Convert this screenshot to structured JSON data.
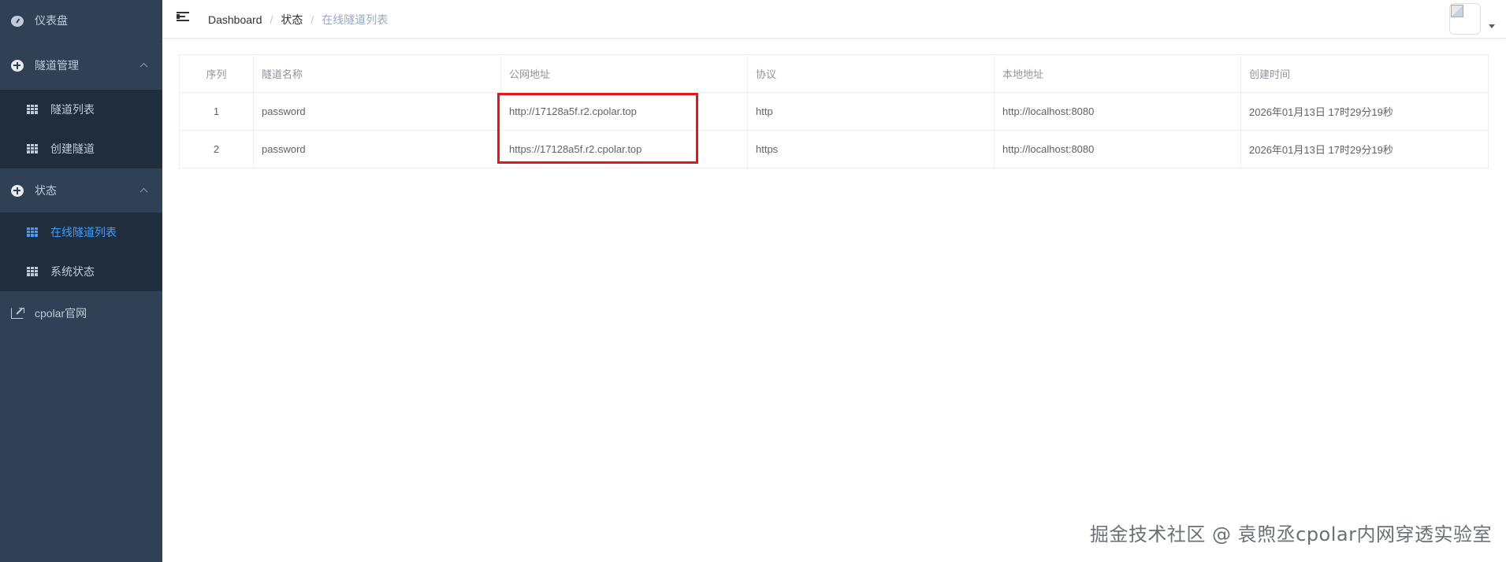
{
  "sidebar": {
    "dashboard": "仪表盘",
    "tunnel_mgmt": {
      "label": "隧道管理",
      "items": [
        "隧道列表",
        "创建隧道"
      ]
    },
    "status": {
      "label": "状态",
      "items": [
        "在线隧道列表",
        "系统状态"
      ]
    },
    "official": "cpolar官网"
  },
  "navbar": {
    "breadcrumb": [
      "Dashboard",
      "状态",
      "在线隧道列表"
    ],
    "separator": "/"
  },
  "table": {
    "headers": [
      "序列",
      "隧道名称",
      "公网地址",
      "协议",
      "本地地址",
      "创建时间"
    ],
    "rows": [
      [
        "1",
        "password",
        "http://17128a5f.r2.cpolar.top",
        "http",
        "http://localhost:8080",
        "2026年01月13日 17时29分19秒"
      ],
      [
        "2",
        "password",
        "https://17128a5f.r2.cpolar.top",
        "https",
        "http://localhost:8080",
        "2026年01月13日 17时29分19秒"
      ]
    ]
  },
  "watermark": "掘金技术社区 @ 袁煦丞cpolar内网穿透实验室",
  "colors": {
    "sidebar_bg": "#304156",
    "submenu_bg": "#1f2d3d",
    "active": "#409eff",
    "highlight": "#e0171f"
  }
}
